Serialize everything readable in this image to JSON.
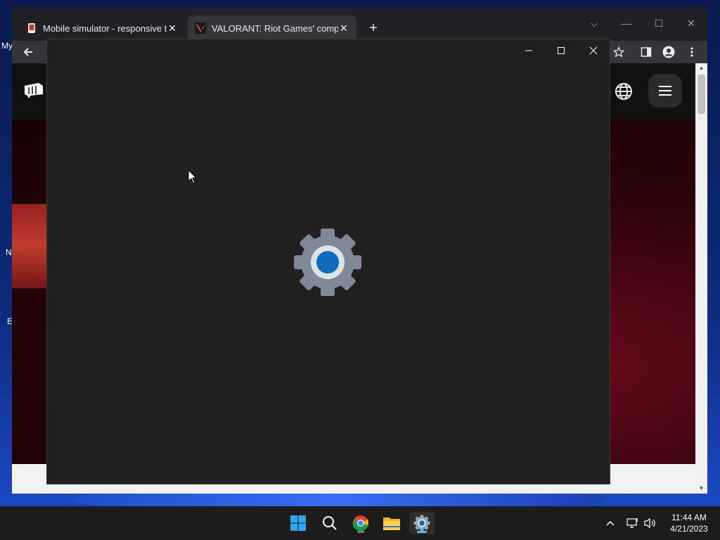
{
  "desktop": {
    "left_labels": [
      "My",
      "N",
      "E"
    ]
  },
  "browser": {
    "tabs": [
      {
        "label": "Mobile simulator - responsive te",
        "active": false,
        "close": "✕"
      },
      {
        "label": "VALORANT: Riot Games' compet",
        "active": true,
        "close": "✕"
      }
    ],
    "new_tab": "+",
    "window_controls": {
      "tab_search": "⌵",
      "minimize": "—",
      "maximize": "☐",
      "close": "✕"
    }
  },
  "settings_window": {
    "controls": {
      "minimize": "—",
      "maximize": "☐",
      "close": "✕"
    },
    "splash_icon": "settings-gear-icon",
    "accent_color": "#0f6cbd"
  },
  "taskbar": {
    "apps": [
      "start-icon",
      "search-icon",
      "chrome-icon",
      "file-explorer-icon",
      "settings-icon"
    ],
    "time": "11:44 AM",
    "date": "4/21/2023"
  }
}
